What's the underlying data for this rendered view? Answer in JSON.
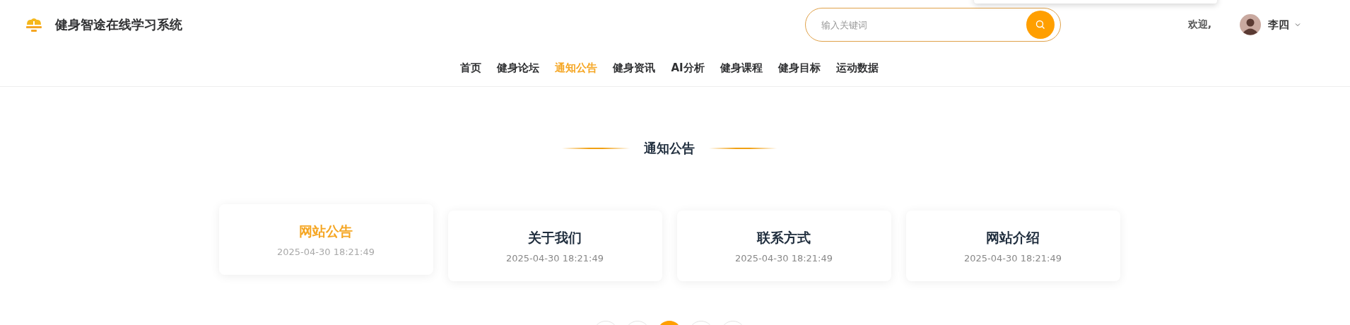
{
  "header": {
    "site_title": "健身智途在线学习系统",
    "search": {
      "placeholder": "输入关键词"
    },
    "welcome": "欢迎,",
    "user": {
      "name": "李四"
    }
  },
  "nav": [
    {
      "label": "首页",
      "selected": false
    },
    {
      "label": "健身论坛",
      "selected": false
    },
    {
      "label": "通知公告",
      "selected": true
    },
    {
      "label": "健身资讯",
      "selected": false
    },
    {
      "label": "AI分析",
      "selected": false
    },
    {
      "label": "健身课程",
      "selected": false
    },
    {
      "label": "健身目标",
      "selected": false
    },
    {
      "label": "运动数据",
      "selected": false
    }
  ],
  "section_title": "通知公告",
  "notices": [
    {
      "title": "网站公告",
      "date": "2025-04-30 18:21:49",
      "hovered": true
    },
    {
      "title": "关于我们",
      "date": "2025-04-30 18:21:49",
      "hovered": false
    },
    {
      "title": "联系方式",
      "date": "2025-04-30 18:21:49",
      "hovered": false
    },
    {
      "title": "网站介绍",
      "date": "2025-04-30 18:21:49",
      "hovered": false
    }
  ],
  "pagination": [
    {
      "selected": false
    },
    {
      "selected": false
    },
    {
      "selected": true
    },
    {
      "selected": false
    },
    {
      "selected": false
    }
  ]
}
